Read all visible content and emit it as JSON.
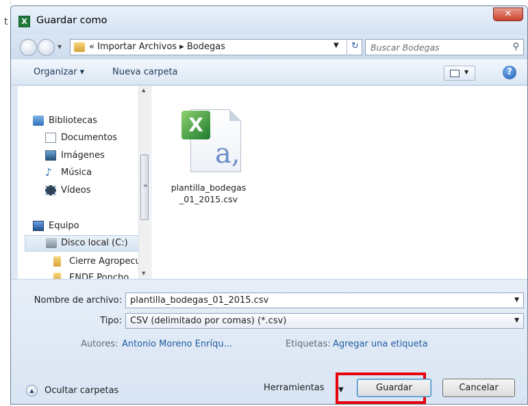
{
  "background": {
    "peek_text": "t"
  },
  "window": {
    "title": "Guardar como",
    "close_glyph": "✕"
  },
  "address_bar": {
    "breadcrumb": "« Importar Archivos ▸ Bodegas",
    "search_placeholder": "Buscar Bodegas"
  },
  "toolbar": {
    "organize": "Organizar ▾",
    "new_folder": "Nueva carpeta",
    "help_glyph": "?"
  },
  "nav": {
    "libraries": "Bibliotecas",
    "documents": "Documentos",
    "images": "Imágenes",
    "music": "Música",
    "videos": "Vídeos",
    "computer": "Equipo",
    "local_disk": "Disco local (C:)",
    "folder1": "Cierre Agropecua",
    "folder2": "ENDE Poncho"
  },
  "files": [
    {
      "name_line1": "plantilla_bodegas",
      "name_line2": "_01_2015.csv",
      "badge": "X",
      "glyph": "a,"
    }
  ],
  "form": {
    "filename_label": "Nombre de archivo:",
    "filename_value": "plantilla_bodegas_01_2015.csv",
    "type_label": "Tipo:",
    "type_value": "CSV (delimitado por comas) (*.csv)",
    "authors_label": "Autores:",
    "authors_value": "Antonio Moreno Enríqu...",
    "tags_label": "Etiquetas:",
    "tags_value": "Agregar una etiqueta"
  },
  "footer": {
    "hide_folders": "Ocultar carpetas",
    "tools": "Herramientas",
    "save": "Guardar",
    "cancel": "Cancelar"
  },
  "colors": {
    "highlight": "#e8000b",
    "link": "#1f5a9e",
    "dialog_bg": "#dfe9f5"
  }
}
